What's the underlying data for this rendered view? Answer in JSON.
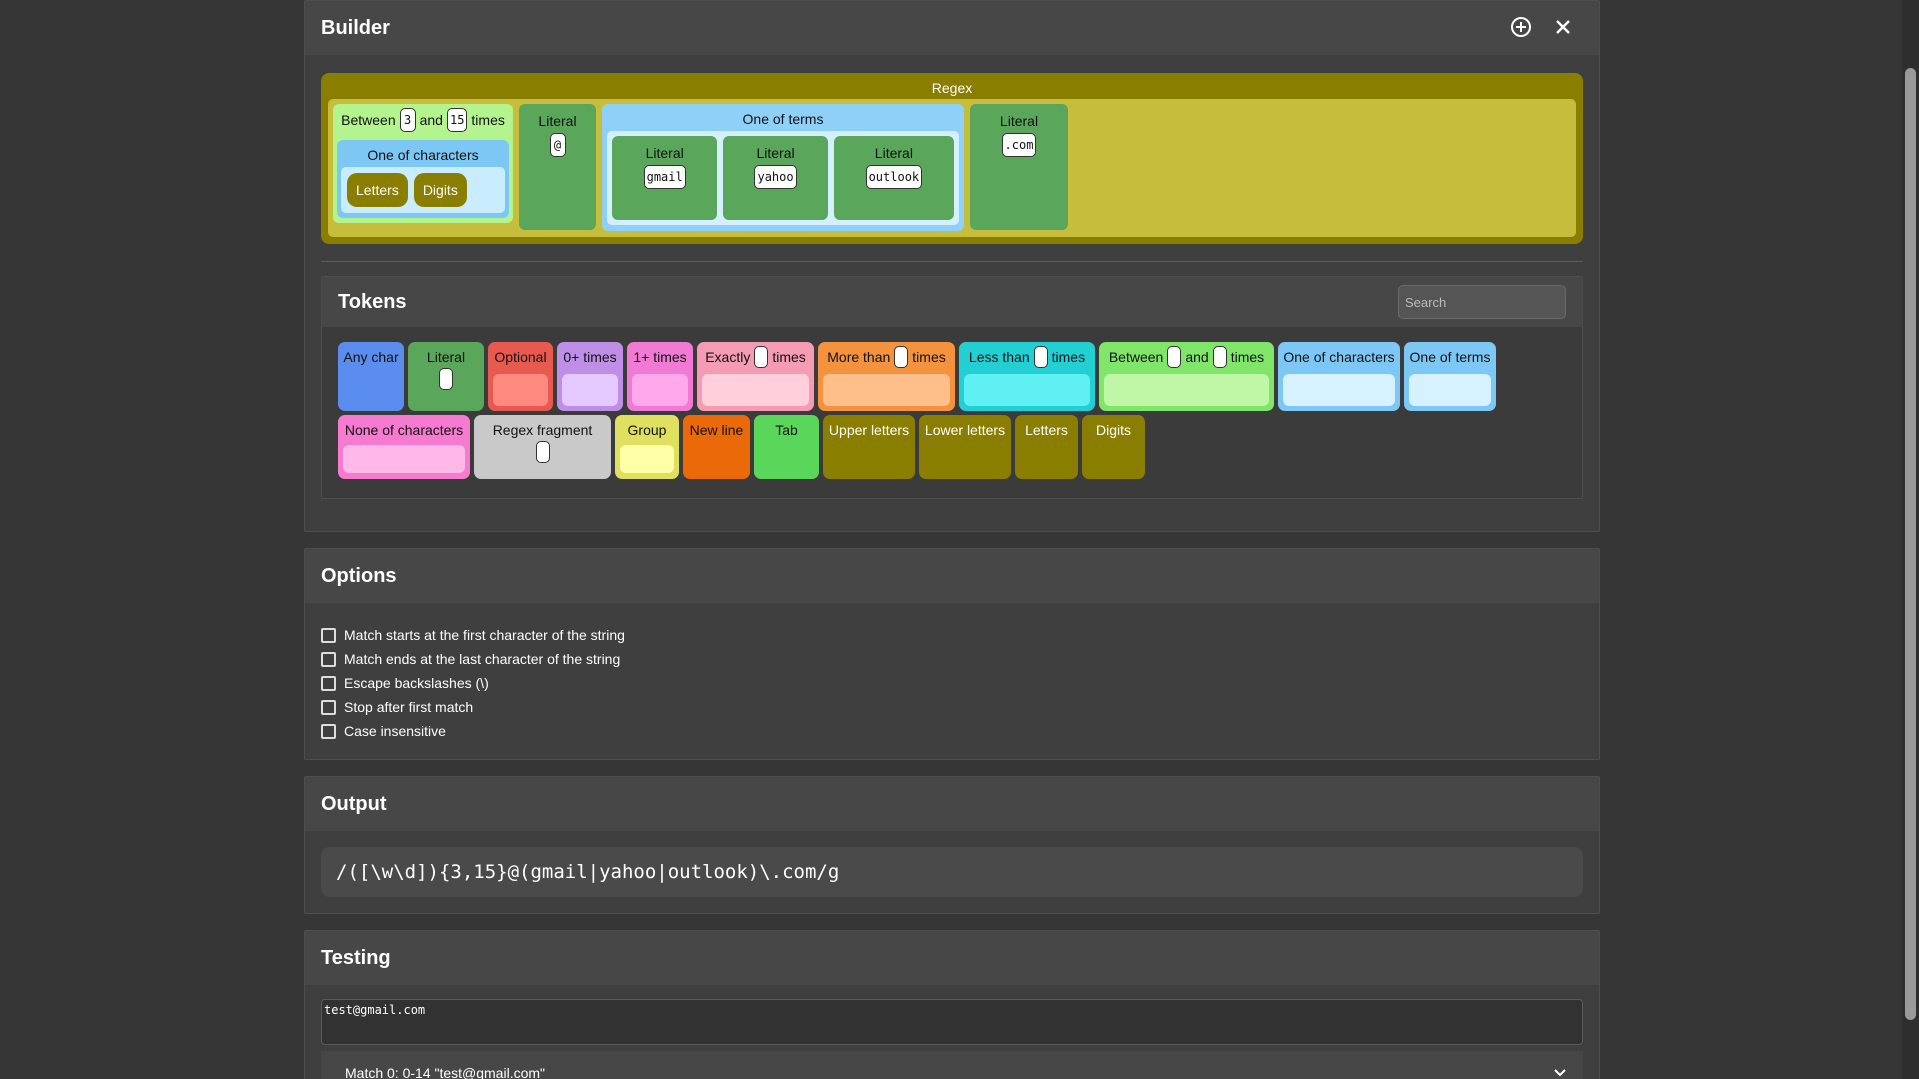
{
  "builder": {
    "title": "Builder",
    "tree": {
      "root_label": "Regex",
      "between": {
        "label_prefix": "Between",
        "min": "3",
        "label_mid": "and",
        "max": "15",
        "label_suffix": "times"
      },
      "one_of_chars": {
        "label": "One of characters",
        "items": [
          "Letters",
          "Digits"
        ]
      },
      "literal_at": {
        "label": "Literal",
        "value": "@"
      },
      "one_of_terms": {
        "label": "One of terms",
        "items": [
          {
            "label": "Literal",
            "value": "gmail"
          },
          {
            "label": "Literal",
            "value": "yahoo"
          },
          {
            "label": "Literal",
            "value": "outlook"
          }
        ]
      },
      "literal_com": {
        "label": "Literal",
        "value": ".com"
      }
    }
  },
  "tokens": {
    "title": "Tokens",
    "search_placeholder": "Search",
    "row1": {
      "any_char": "Any char",
      "literal": "Literal",
      "optional": "Optional",
      "zero_plus": "0+ times",
      "one_plus": "1+ times",
      "exactly": {
        "a": "Exactly",
        "b": "times"
      },
      "more_than": {
        "a": "More than",
        "b": "times"
      },
      "less_than": {
        "a": "Less than",
        "b": "times"
      },
      "between": {
        "a": "Between",
        "b": "and",
        "c": "times"
      },
      "one_of_chars": "One of characters",
      "one_of_terms": "One of terms"
    },
    "row2": {
      "none_of_chars": "None of characters",
      "regex_fragment": "Regex fragment",
      "group": "Group",
      "new_line": "New line",
      "tab": "Tab",
      "upper": "Upper letters",
      "lower": "Lower letters",
      "letters": "Letters",
      "digits": "Digits"
    },
    "colors": {
      "any_char": "#5b8def",
      "literal": "#5aa65a",
      "optional": "#e85a4f",
      "zero_plus": "#bf8fe8",
      "one_plus": "#f07ad4",
      "exactly": "#f59bb4",
      "more_than": "#f5923e",
      "less_than": "#22d0d4",
      "between": "#7fe66a",
      "one_of": "#7dc7f5",
      "none_of": "#f57ad0",
      "fragment": "#c9c9c9",
      "group": "#e0e060",
      "new_line": "#ea6a0a",
      "tab": "#5ad65a",
      "olive": "#8a7e00"
    }
  },
  "options": {
    "title": "Options",
    "items": [
      "Match starts at the first character of the string",
      "Match ends at the last character of the string",
      "Escape backslashes (\\)",
      "Stop after first match",
      "Case insensitive"
    ]
  },
  "output": {
    "title": "Output",
    "regex": "/([\\w\\d]){3,15}@(gmail|yahoo|outlook)\\.com/g"
  },
  "testing": {
    "title": "Testing",
    "input": "test@gmail.com",
    "match": "Match 0: 0-14 \"test@gmail.com\""
  }
}
